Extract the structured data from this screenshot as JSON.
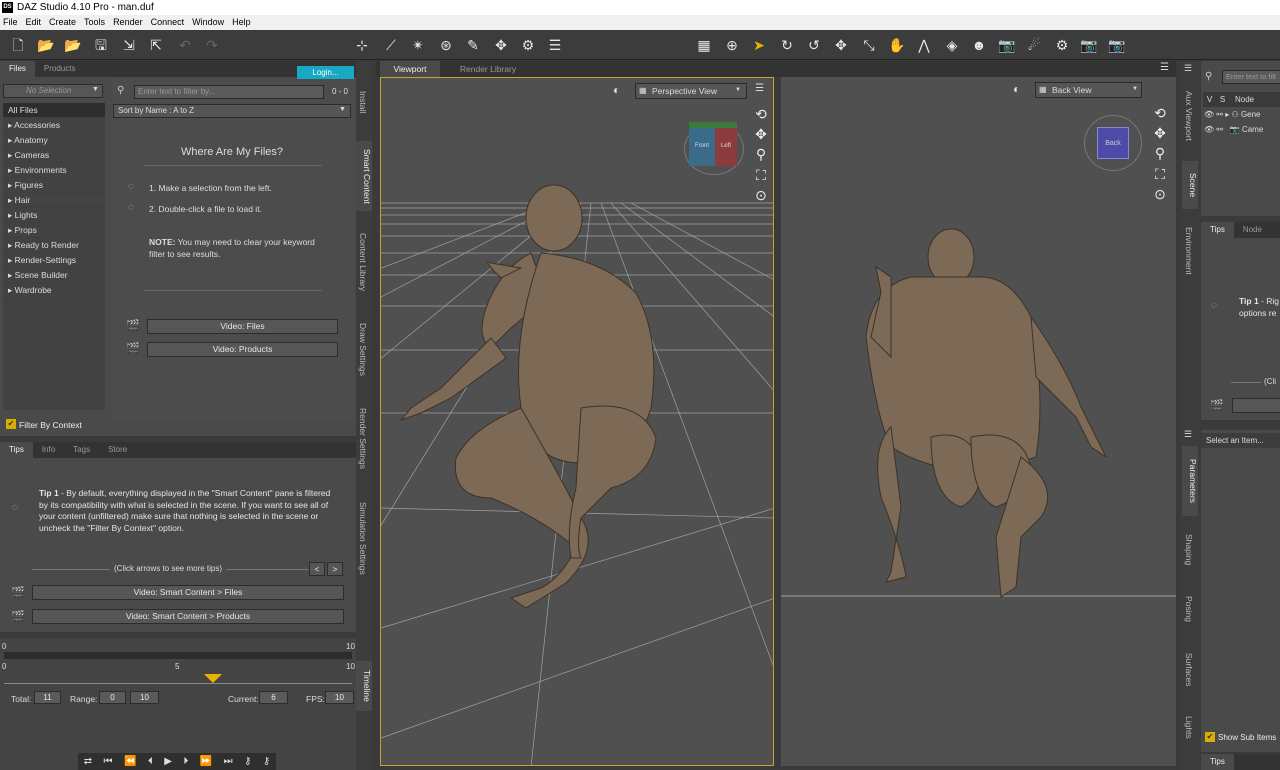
{
  "window": {
    "title": "DAZ Studio 4.10 Pro - man.duf",
    "logo": "DS"
  },
  "menu": [
    "File",
    "Edit",
    "Create",
    "Tools",
    "Render",
    "Connect",
    "Window",
    "Help"
  ],
  "left": {
    "tabs": [
      "Files",
      "Products"
    ],
    "login": "Login...",
    "filter_placeholder": "Enter text to filter by...",
    "selection": "No Selection",
    "count": "0 - 0",
    "sort": "Sort by Name : A to Z",
    "categories": [
      "All Files",
      "Accessories",
      "Anatomy",
      "Cameras",
      "Environments",
      "Figures",
      "Hair",
      "Lights",
      "Props",
      "Ready to Render",
      "Render-Settings",
      "Scene Builder",
      "Wardrobe"
    ],
    "where_title": "Where Are My Files?",
    "step1": "1. Make a selection from the left.",
    "step2": "2. Double-click a file to load it.",
    "note_label": "NOTE:",
    "note_text": "You may need to clear your keyword filter to see results.",
    "video_files": "Video: Files",
    "video_products": "Video:  Products",
    "filter_context": "Filter By Context"
  },
  "tips": {
    "tabs": [
      "Tips",
      "Info",
      "Tags",
      "Store"
    ],
    "tip_label": "Tip 1",
    "tip_text": " - By default, everything displayed in the \"Smart Content\" pane is filtered by its compatibility with what is selected in the scene. If you want to see all of your content (unfiltered) make sure that nothing is selected in the scene or uncheck the \"Filter By Context\" option.",
    "arrows": "(Click arrows to see more tips)",
    "btn1": "Video: Smart Content > Files",
    "btn2": "Video: Smart Content > Products"
  },
  "vtabs_left": [
    "Install",
    "Smart Content",
    "Content Library",
    "Draw Settings",
    "Render Settings",
    "Simulation Settings",
    "Timeline"
  ],
  "timeline": {
    "top_start": "0",
    "top_end": "10",
    "t0": "0",
    "t5": "5",
    "t10": "10",
    "current_frame": 6,
    "total_label": "Total:",
    "total": "11",
    "range_label": "Range:",
    "range_start": "0",
    "range_end": "10",
    "current_label": "Current:",
    "current": "6",
    "fps_label": "FPS:",
    "fps": "10"
  },
  "viewport": {
    "tabs": [
      "Viewport",
      "Render Library"
    ],
    "left_view": "Perspective View",
    "right_view": "Back View",
    "cube_front": "Front",
    "cube_left": "Left",
    "cube_back": "Back"
  },
  "right": {
    "vtabs_top": [
      "Aux Viewport",
      "Scene",
      "Environment"
    ],
    "vtabs_bottom": [
      "Parameters",
      "Shaping",
      "Posing",
      "Surfaces",
      "Lights"
    ],
    "filter_placeholder": "Enter text to filt",
    "cols": [
      "V",
      "S",
      "Node"
    ],
    "nodes": [
      "Gene",
      "Came"
    ],
    "tips_tabs": [
      "Tips",
      "Node"
    ],
    "tip_label": "Tip 1",
    "tip_text": " - Rig options re",
    "click": "(Cli",
    "select_item": "Select an Item...",
    "show_sub": "Show Sub Items",
    "bottom_tab": "Tips"
  },
  "colors": {
    "accent": "#17a8c4",
    "highlight": "#e8b300",
    "checkbox": "#d6b000"
  }
}
